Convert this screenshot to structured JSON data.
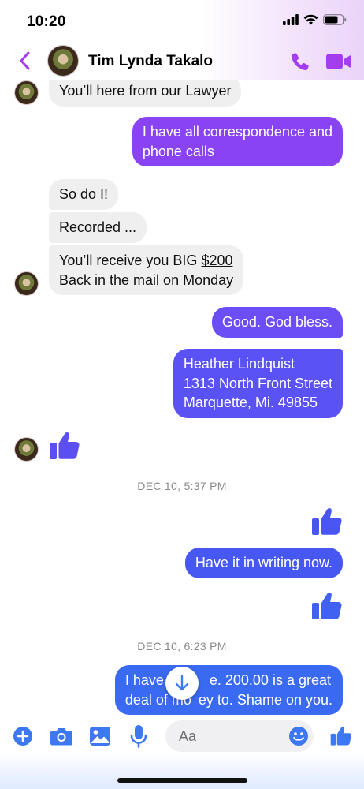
{
  "status_bar": {
    "time": "10:20",
    "icons": [
      "cellular-signal-icon",
      "wifi-icon",
      "battery-icon"
    ]
  },
  "header": {
    "contact_name": "Tim Lynda Takalo",
    "icons": [
      "back-chevron-icon",
      "phone-call-icon",
      "video-call-icon"
    ]
  },
  "colors": {
    "accent_purple": "#a43cf0",
    "bubble_purple": "#8e44f5",
    "bubble_violet": "#6d4ef5",
    "bubble_blue": "#4a58f2",
    "incoming_bubble": "#efefef"
  },
  "messages": [
    {
      "direction": "incoming",
      "text": "You’ll here from our Lawyer"
    },
    {
      "direction": "outgoing",
      "lines": [
        "I have all correspondence and",
        "phone calls"
      ]
    },
    {
      "direction": "incoming",
      "text": "So do I!"
    },
    {
      "direction": "incoming",
      "text": "Recorded ..."
    },
    {
      "direction": "incoming",
      "lines": [
        "You’ll receive you BIG ",
        "$200",
        "Back in the mail on Monday"
      ]
    },
    {
      "direction": "outgoing",
      "text": "Good. God bless."
    },
    {
      "direction": "outgoing",
      "lines": [
        "Heather Lindquist",
        "1313 North Front Street",
        "Marquette, Mi. 49855"
      ]
    },
    {
      "direction": "incoming",
      "type": "thumbs-up"
    },
    {
      "type": "timestamp",
      "text": "DEC 10, 5:37 PM"
    },
    {
      "direction": "outgoing",
      "type": "thumbs-up"
    },
    {
      "direction": "outgoing",
      "text": "Have it in writing now."
    },
    {
      "direction": "outgoing",
      "type": "thumbs-up"
    },
    {
      "type": "timestamp",
      "text": "DEC 10, 6:23 PM"
    },
    {
      "direction": "outgoing",
      "lines": [
        "I have ve",
        "e. 200.00 is a great",
        "deal of mo",
        "ey to. Shame on you."
      ]
    }
  ],
  "composer": {
    "placeholder": "Aa",
    "icons": [
      "plus-icon",
      "camera-icon",
      "photo-icon",
      "microphone-icon",
      "emoji-icon",
      "thumbs-up-icon"
    ]
  }
}
